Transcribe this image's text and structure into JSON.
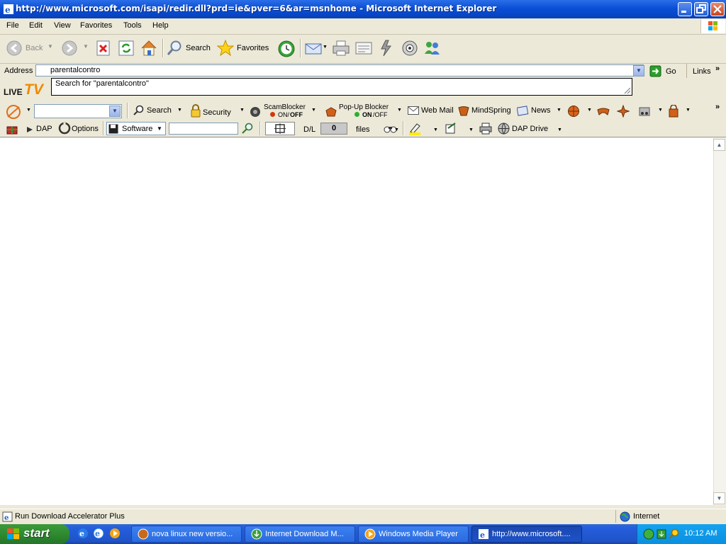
{
  "window": {
    "title": "http://www.microsoft.com/isapi/redir.dll?prd=ie&pver=6&ar=msnhome - Microsoft Internet Explorer"
  },
  "menubar": {
    "items": [
      "File",
      "Edit",
      "View",
      "Favorites",
      "Tools",
      "Help"
    ]
  },
  "toolbar": {
    "back_label": "Back",
    "search_label": "Search",
    "favorites_label": "Favorites"
  },
  "addressbar": {
    "label": "Address",
    "value": "parentalcontro",
    "go_label": "Go",
    "links_label": "Links"
  },
  "autocomplete": {
    "suggestion": "Search for \"parentalcontro\""
  },
  "livetv": {
    "logo_small": "LIVE",
    "logo_big": "TV"
  },
  "earthlink_toolbar": {
    "search_label": "Search",
    "security_label": "Security",
    "scamblocker_label": "ScamBlocker",
    "scamblocker_on": "ON/",
    "scamblocker_off": "OFF",
    "popup_label": "Pop-Up Blocker",
    "popup_on": "ON",
    "popup_off": "/OFF",
    "webmail_label": "Web Mail",
    "mindspring_label": "MindSpring",
    "news_label": "News"
  },
  "dap_toolbar": {
    "dap_label": "DAP",
    "options_label": "Options",
    "category_value": "Software",
    "dl_label": "D/L",
    "dl_count": "0",
    "files_label": "files",
    "dapdrive_label": "DAP Drive"
  },
  "statusbar": {
    "text": "Run Download Accelerator Plus",
    "zone": "Internet"
  },
  "taskbar": {
    "start_label": "start",
    "buttons": [
      "nova linux new versio...",
      "Internet Download M...",
      "Windows Media Player",
      "http://www.microsoft...."
    ],
    "clock": "10:12 AM"
  }
}
